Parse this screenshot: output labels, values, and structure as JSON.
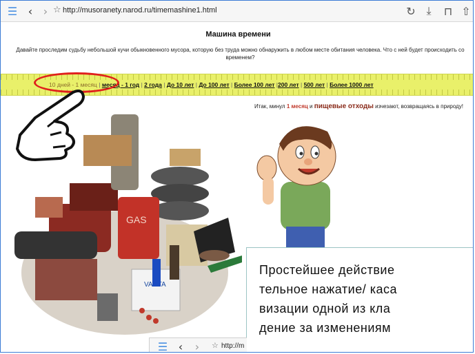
{
  "browser": {
    "url": "http://musoranety.narod.ru/timemashine1.html",
    "icons": [
      "menu-icon",
      "back-icon",
      "forward-icon",
      "star-icon",
      "reload-icon",
      "download-icon",
      "book-icon",
      "share-icon"
    ]
  },
  "page": {
    "title": "Машина времени",
    "intro": "Давайте проследим судьбу небольшой кучи обыкновенного мусора, которую без труда можно обнаружить в любом месте обитания человека. Что с ней будет происходить со временем?",
    "nav": [
      {
        "label": "10 дней - 1 месяц",
        "active": true
      },
      {
        "label": "месяц - 1 год"
      },
      {
        "label": "2 года"
      },
      {
        "label": "До 10 лет"
      },
      {
        "label": "До 100 лет"
      },
      {
        "label": "Более 100 лет"
      },
      {
        "label": "200 лет"
      },
      {
        "label": "500 лет"
      },
      {
        "label": "Более 1000 лет"
      }
    ],
    "story_prefix": "Итак, минул ",
    "story_month": "1 месяц",
    "story_mid": " и ",
    "story_food": "пищевые отходы",
    "story_suffix": " изчезают, возвращаясь в природу!"
  },
  "overlay": {
    "lines": [
      "Простейшее действие",
      "тельное нажатие/ каса",
      "визации одной из кла",
      "дение за изменениям"
    ]
  },
  "mini_browser": {
    "url": "http://m"
  },
  "colors": {
    "accent": "#3a7bd5",
    "ruler": "#e9f06a",
    "highlight": "#e0201c"
  }
}
